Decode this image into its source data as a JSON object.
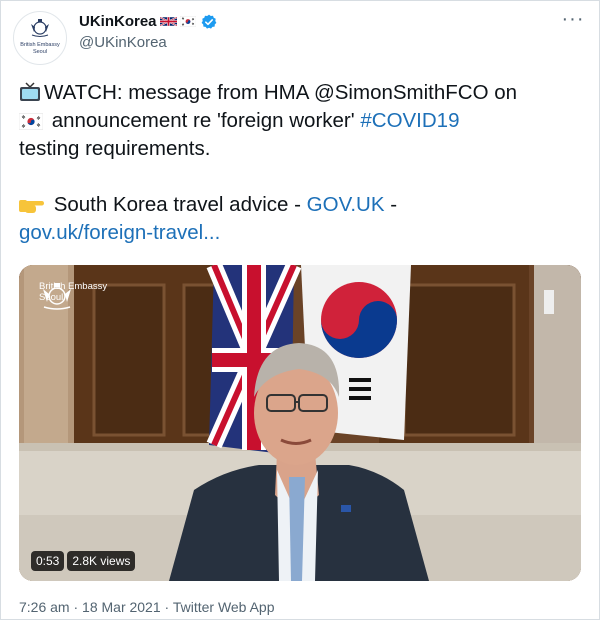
{
  "tweet": {
    "display_name": "UKinKorea",
    "handle": "@UKinKorea",
    "avatar_text": [
      "British Embassy",
      "Seoul"
    ],
    "lines": {
      "l1_text": "WATCH: message from HMA @SimonSmithFCO on",
      "l2_text": " announcement re 'foreign worker' ",
      "l2_hashtag": "#COVID19",
      "l3_text": "testing requirements.",
      "l4_text": " South Korea travel advice - ",
      "l4_link": "GOV.UK",
      "l4_tail": " -",
      "l5_link": "gov.uk/foreign-travel..."
    },
    "media": {
      "watermark": [
        "British Embassy",
        "Seoul"
      ],
      "duration": "0:53",
      "views": "2.8K views"
    },
    "footer": "7:26 am · 18 Mar 2021 · Twitter Web App"
  },
  "colors": {
    "link": "#1d70b8",
    "verified": "#1d9bf0",
    "muted": "#536471"
  },
  "icons": [
    "crest-icon",
    "uk-flag-icon",
    "korea-flag-icon",
    "verified-badge-icon",
    "more-options-icon",
    "television-icon",
    "pointing-hand-icon"
  ]
}
